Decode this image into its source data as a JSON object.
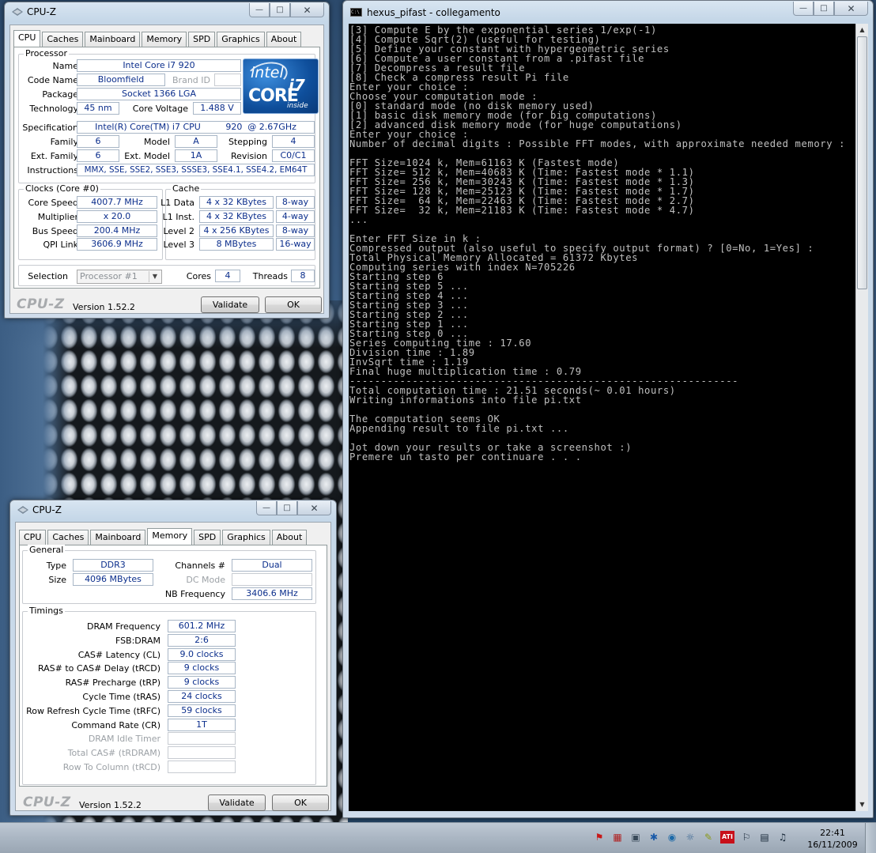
{
  "cpuz_cpu": {
    "title": "CPU-Z",
    "tabs": [
      "CPU",
      "Caches",
      "Mainboard",
      "Memory",
      "SPD",
      "Graphics",
      "About"
    ],
    "active_tab": "CPU",
    "processor": {
      "group_label": "Processor",
      "name_label": "Name",
      "name": "Intel Core i7 920",
      "code_name_label": "Code Name",
      "code_name": "Bloomfield",
      "brand_id_label": "Brand ID",
      "brand_id": "",
      "package_label": "Package",
      "package": "Socket 1366 LGA",
      "technology_label": "Technology",
      "technology": "45 nm",
      "core_voltage_label": "Core Voltage",
      "core_voltage": "1.488 V",
      "specification_label": "Specification",
      "specification": "Intel(R) Core(TM) i7 CPU         920  @ 2.67GHz",
      "family_label": "Family",
      "family": "6",
      "model_label": "Model",
      "model": "A",
      "stepping_label": "Stepping",
      "stepping": "4",
      "ext_family_label": "Ext. Family",
      "ext_family": "6",
      "ext_model_label": "Ext. Model",
      "ext_model": "1A",
      "revision_label": "Revision",
      "revision": "C0/C1",
      "instructions_label": "Instructions",
      "instructions": "MMX, SSE, SSE2, SSE3, SSSE3, SSE4.1, SSE4.2, EM64T"
    },
    "intel_logo": {
      "brand": "intel",
      "product": "CORE",
      "tier": "i7",
      "suffix": "inside"
    },
    "clocks": {
      "group_label": "Clocks (Core #0)",
      "core_speed_label": "Core Speed",
      "core_speed": "4007.7 MHz",
      "multiplier_label": "Multiplier",
      "multiplier": "x 20.0",
      "bus_speed_label": "Bus Speed",
      "bus_speed": "200.4 MHz",
      "qpi_link_label": "QPI Link",
      "qpi_link": "3606.9 MHz"
    },
    "cache": {
      "group_label": "Cache",
      "l1d_label": "L1 Data",
      "l1d_size": "4 x 32 KBytes",
      "l1d_way": "8-way",
      "l1i_label": "L1 Inst.",
      "l1i_size": "4 x 32 KBytes",
      "l1i_way": "4-way",
      "l2_label": "Level 2",
      "l2_size": "4 x 256 KBytes",
      "l2_way": "8-way",
      "l3_label": "Level 3",
      "l3_size": "8 MBytes",
      "l3_way": "16-way"
    },
    "selection_label": "Selection",
    "selection": "Processor #1",
    "cores_label": "Cores",
    "cores": "4",
    "threads_label": "Threads",
    "threads": "8",
    "footer_logo": "CPU-Z",
    "version": "Version 1.52.2",
    "validate": "Validate",
    "ok": "OK"
  },
  "cpuz_mem": {
    "title": "CPU-Z",
    "tabs": [
      "CPU",
      "Caches",
      "Mainboard",
      "Memory",
      "SPD",
      "Graphics",
      "About"
    ],
    "active_tab": "Memory",
    "general": {
      "group_label": "General",
      "type_label": "Type",
      "type": "DDR3",
      "size_label": "Size",
      "size": "4096 MBytes",
      "channels_label": "Channels #",
      "channels": "Dual",
      "dc_mode_label": "DC Mode",
      "dc_mode": "",
      "nb_freq_label": "NB Frequency",
      "nb_freq": "3406.6 MHz"
    },
    "timings": {
      "group_label": "Timings",
      "rows": [
        {
          "label": "DRAM Frequency",
          "value": "601.2 MHz",
          "disabled": false
        },
        {
          "label": "FSB:DRAM",
          "value": "2:6",
          "disabled": false
        },
        {
          "label": "CAS# Latency (CL)",
          "value": "9.0 clocks",
          "disabled": false
        },
        {
          "label": "RAS# to CAS# Delay (tRCD)",
          "value": "9 clocks",
          "disabled": false
        },
        {
          "label": "RAS# Precharge (tRP)",
          "value": "9 clocks",
          "disabled": false
        },
        {
          "label": "Cycle Time (tRAS)",
          "value": "24 clocks",
          "disabled": false
        },
        {
          "label": "Row Refresh Cycle Time (tRFC)",
          "value": "59 clocks",
          "disabled": false
        },
        {
          "label": "Command Rate (CR)",
          "value": "1T",
          "disabled": false
        },
        {
          "label": "DRAM Idle Timer",
          "value": "",
          "disabled": true
        },
        {
          "label": "Total CAS# (tRDRAM)",
          "value": "",
          "disabled": true
        },
        {
          "label": "Row To Column (tRCD)",
          "value": "",
          "disabled": true
        }
      ]
    },
    "footer_logo": "CPU-Z",
    "version": "Version 1.52.2",
    "validate": "Validate",
    "ok": "OK"
  },
  "console": {
    "title": "hexus_pifast - collegamento",
    "icon_text": "C:\\",
    "lines": [
      "[3] Compute E by the exponential series 1/exp(-1)",
      "[4] Compute Sqrt(2) (useful for testing)",
      "[5] Define your constant with hypergeometric series",
      "[6] Compute a user constant from a .pifast file",
      "[7] Decompress a result file",
      "[8] Check a compress result Pi file",
      "Enter your choice :",
      "Choose your computation mode :",
      "[0] standard mode (no disk memory used)",
      "[1] basic disk memory mode (for big computations)",
      "[2] advanced disk memory mode (for huge computations)",
      "Enter your choice :",
      "Number of decimal digits : Possible FFT modes, with approximate needed memory :",
      "",
      "FFT Size=1024 k, Mem=61163 K (Fastest mode)",
      "FFT Size= 512 k, Mem=40683 K (Time: Fastest mode * 1.1)",
      "FFT Size= 256 k, Mem=30243 K (Time: Fastest mode * 1.3)",
      "FFT Size= 128 k, Mem=25123 K (Time: Fastest mode * 1.7)",
      "FFT Size=  64 k, Mem=22463 K (Time: Fastest mode * 2.7)",
      "FFT Size=  32 k, Mem=21183 K (Time: Fastest mode * 4.7)",
      "...",
      "",
      "Enter FFT Size in k :",
      "Compressed output (also useful to specify output format) ? [0=No, 1=Yes] :",
      "Total Physical Memory Allocated = 61372 Kbytes",
      "Computing series with index N=705226",
      "Starting step 6",
      "Starting step 5 ...",
      "Starting step 4 ...",
      "Starting step 3 ...",
      "Starting step 2 ...",
      "Starting step 1 ...",
      "Starting step 0 ...",
      "Series computing time : 17.60",
      "Division time : 1.89",
      "InvSqrt time : 1.19",
      "Final huge multiplication time : 0.79",
      "--------------------------------------------------------------",
      "Total computation time : 21.51 seconds(~ 0.01 hours)",
      "Writing informations into file pi.txt",
      "",
      "The computation seems OK",
      "Appending result to file pi.txt ...",
      "",
      "Jot down your results or take a screenshot :)",
      "Premere un tasto per continuare . . ."
    ]
  },
  "taskbar": {
    "tray_icons": [
      "flag-red-icon",
      "network-monitor-icon",
      "app-icon",
      "bluetooth-icon",
      "globe-icon",
      "update-icon",
      "pen-icon",
      "ati-icon",
      "action-center-icon",
      "network-icon",
      "volume-icon"
    ],
    "ati_label": "ATI",
    "time": "22:41",
    "date": "16/11/2009"
  }
}
